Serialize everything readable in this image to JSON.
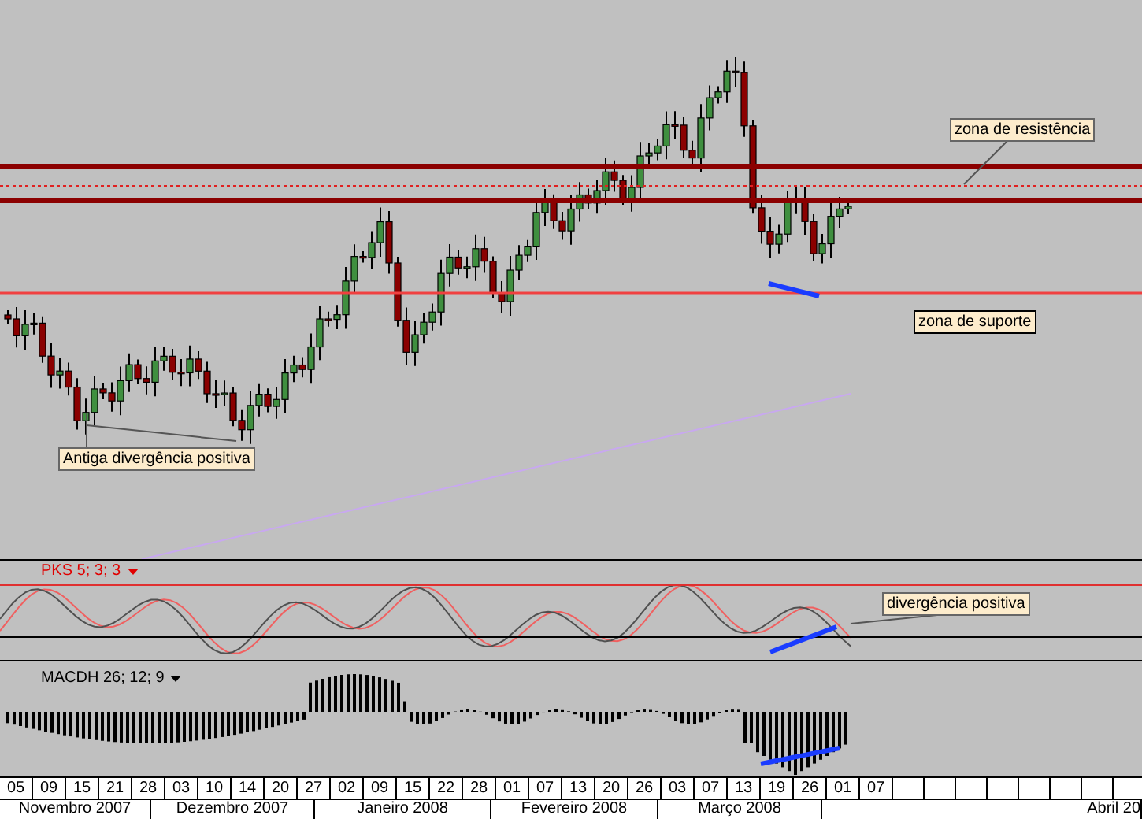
{
  "chart": {
    "annotations": [
      {
        "kind": "resistance",
        "text": "zona de resistência"
      },
      {
        "kind": "support",
        "text": "zona de suporte"
      },
      {
        "kind": "old_divergence",
        "text": "Antiga divergência positiva"
      }
    ]
  },
  "indicators": [
    {
      "kind": "stochastic",
      "label": "PKS 5; 3; 3",
      "note": "divergência positiva"
    },
    {
      "kind": "histogram",
      "label": "MACDH 26; 12; 9"
    }
  ],
  "axis": {
    "days": [
      "05",
      "09",
      "15",
      "21",
      "28",
      "03",
      "10",
      "14",
      "20",
      "27",
      "02",
      "09",
      "15",
      "22",
      "28",
      "01",
      "07",
      "13",
      "20",
      "26",
      "03",
      "07",
      "13",
      "19",
      "26",
      "01",
      "07"
    ],
    "months": [
      "Novembro 2007",
      "Dezembro 2007",
      "Janeiro 2008",
      "Fevereiro 2008",
      "Março 2008",
      "Abril 20"
    ]
  }
}
